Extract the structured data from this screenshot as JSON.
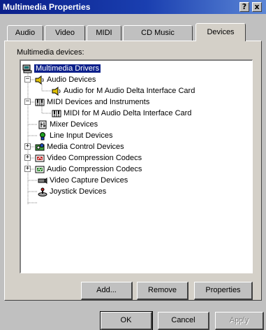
{
  "window": {
    "title": "Multimedia Properties",
    "help_button": "?",
    "close_button": "x"
  },
  "tabs": [
    {
      "label": "Audio"
    },
    {
      "label": "Video"
    },
    {
      "label": "MIDI"
    },
    {
      "label": "CD Music"
    },
    {
      "label": "Devices"
    }
  ],
  "devices": {
    "group_label": "Multimedia devices:",
    "tree": [
      {
        "label": "Multimedia Drivers"
      },
      {
        "label": "Audio Devices"
      },
      {
        "label": "Audio for M Audio Delta Interface Card"
      },
      {
        "label": "MIDI Devices and Instruments"
      },
      {
        "label": "MIDI for M Audio Delta Interface Card"
      },
      {
        "label": "Mixer Devices"
      },
      {
        "label": "Line Input Devices"
      },
      {
        "label": "Media Control Devices"
      },
      {
        "label": "Video Compression Codecs"
      },
      {
        "label": "Audio Compression Codecs"
      },
      {
        "label": "Video Capture Devices"
      },
      {
        "label": "Joystick Devices"
      }
    ]
  },
  "buttons": {
    "add": "Add...",
    "remove": "Remove",
    "properties": "Properties",
    "ok": "OK",
    "cancel": "Cancel",
    "apply": "Apply"
  }
}
